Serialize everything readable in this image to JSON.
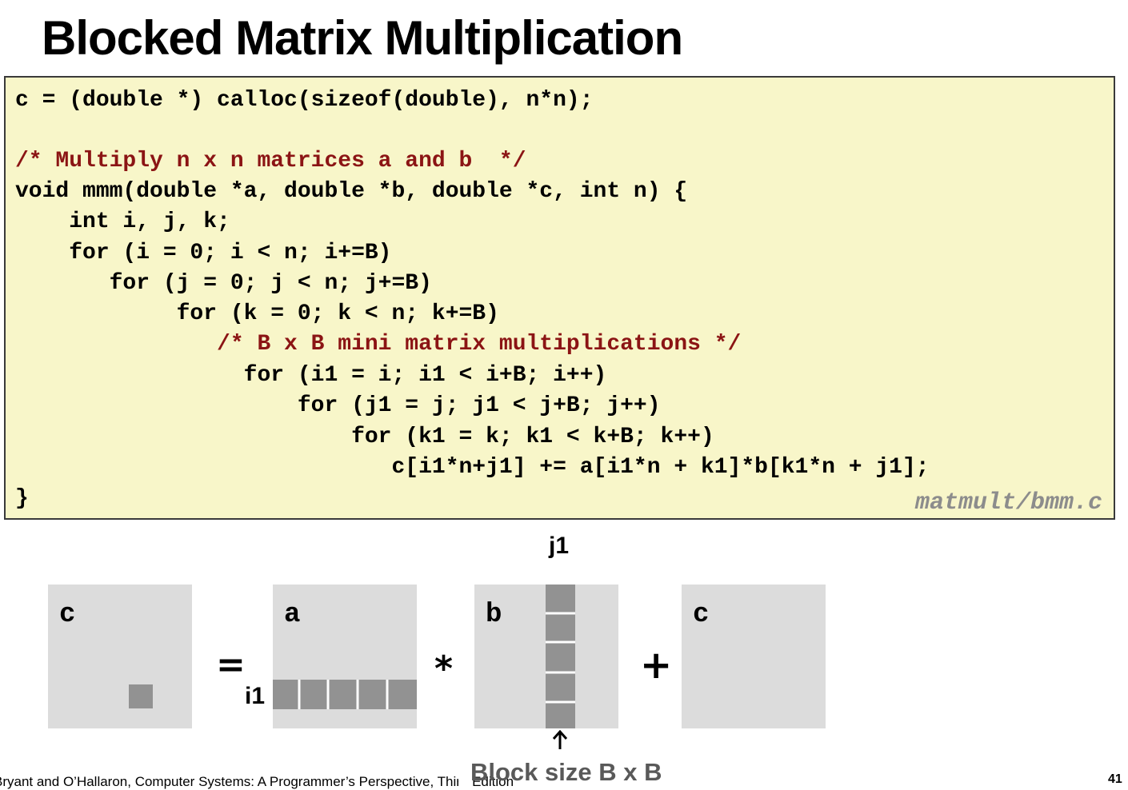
{
  "title": "Blocked Matrix Multiplication",
  "code": {
    "lines": [
      "c = (double *) calloc(sizeof(double), n*n);",
      "",
      "/* Multiply n x n matrices a and b  */",
      "void mmm(double *a, double *b, double *c, int n) {",
      "    int i, j, k;",
      "    for (i = 0; i < n; i+=B)",
      "       for (j = 0; j < n; j+=B)",
      "            for (k = 0; k < n; k+=B)",
      "               /* B x B mini matrix multiplications */",
      "                 for (i1 = i; i1 < i+B; i++)",
      "                     for (j1 = j; j1 < j+B; j++)",
      "                         for (k1 = k; k1 < k+B; k++)",
      "                            c[i1*n+j1] += a[i1*n + k1]*b[k1*n + j1];",
      "}"
    ],
    "filename": "matmult/bmm.c"
  },
  "diagram": {
    "matrix_c_left": "c",
    "matrix_a": "a",
    "matrix_b": "b",
    "matrix_c_right": "c",
    "equals": "=",
    "times": "*",
    "plus": "+",
    "row_index": "i1",
    "col_index": "j1",
    "block_size": "Block size B x B"
  },
  "footer": {
    "citation": "Bryant and O’Hallaron, Computer Systems: A Programmer’s Perspective, Third Edition",
    "page_number": "41"
  },
  "colors": {
    "code_background": "#f8f6c9",
    "comment": "#8b1414",
    "matrix": "#dcdcdc",
    "block": "#929292"
  }
}
